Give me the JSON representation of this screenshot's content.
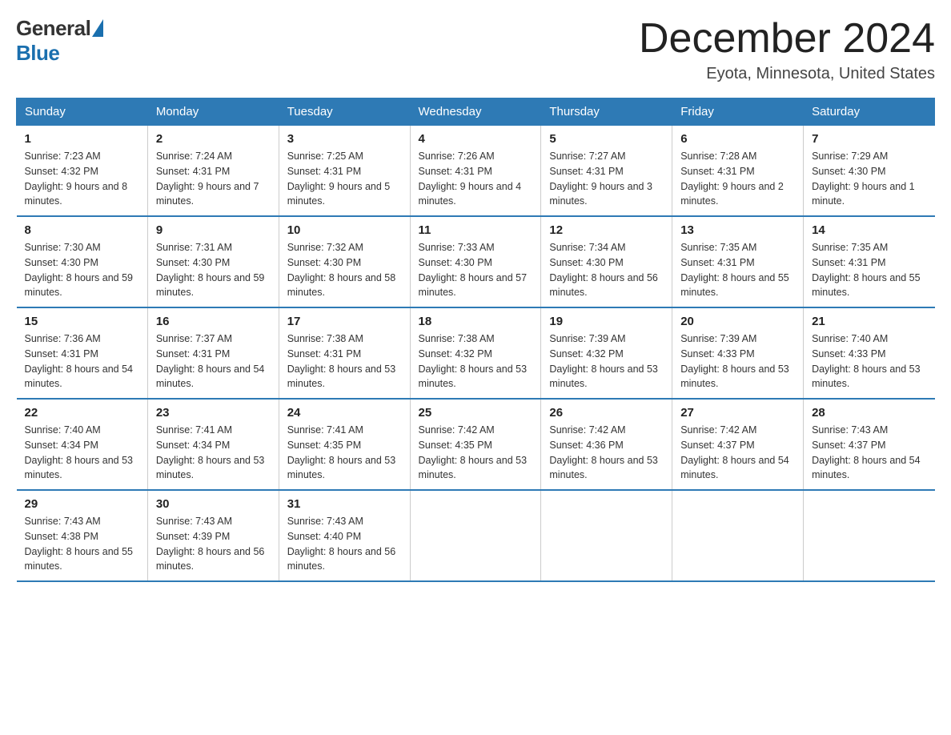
{
  "logo": {
    "general": "General",
    "blue": "Blue"
  },
  "title": "December 2024",
  "subtitle": "Eyota, Minnesota, United States",
  "headers": [
    "Sunday",
    "Monday",
    "Tuesday",
    "Wednesday",
    "Thursday",
    "Friday",
    "Saturday"
  ],
  "weeks": [
    [
      {
        "day": "1",
        "sunrise": "7:23 AM",
        "sunset": "4:32 PM",
        "daylight": "9 hours and 8 minutes."
      },
      {
        "day": "2",
        "sunrise": "7:24 AM",
        "sunset": "4:31 PM",
        "daylight": "9 hours and 7 minutes."
      },
      {
        "day": "3",
        "sunrise": "7:25 AM",
        "sunset": "4:31 PM",
        "daylight": "9 hours and 5 minutes."
      },
      {
        "day": "4",
        "sunrise": "7:26 AM",
        "sunset": "4:31 PM",
        "daylight": "9 hours and 4 minutes."
      },
      {
        "day": "5",
        "sunrise": "7:27 AM",
        "sunset": "4:31 PM",
        "daylight": "9 hours and 3 minutes."
      },
      {
        "day": "6",
        "sunrise": "7:28 AM",
        "sunset": "4:31 PM",
        "daylight": "9 hours and 2 minutes."
      },
      {
        "day": "7",
        "sunrise": "7:29 AM",
        "sunset": "4:30 PM",
        "daylight": "9 hours and 1 minute."
      }
    ],
    [
      {
        "day": "8",
        "sunrise": "7:30 AM",
        "sunset": "4:30 PM",
        "daylight": "8 hours and 59 minutes."
      },
      {
        "day": "9",
        "sunrise": "7:31 AM",
        "sunset": "4:30 PM",
        "daylight": "8 hours and 59 minutes."
      },
      {
        "day": "10",
        "sunrise": "7:32 AM",
        "sunset": "4:30 PM",
        "daylight": "8 hours and 58 minutes."
      },
      {
        "day": "11",
        "sunrise": "7:33 AM",
        "sunset": "4:30 PM",
        "daylight": "8 hours and 57 minutes."
      },
      {
        "day": "12",
        "sunrise": "7:34 AM",
        "sunset": "4:30 PM",
        "daylight": "8 hours and 56 minutes."
      },
      {
        "day": "13",
        "sunrise": "7:35 AM",
        "sunset": "4:31 PM",
        "daylight": "8 hours and 55 minutes."
      },
      {
        "day": "14",
        "sunrise": "7:35 AM",
        "sunset": "4:31 PM",
        "daylight": "8 hours and 55 minutes."
      }
    ],
    [
      {
        "day": "15",
        "sunrise": "7:36 AM",
        "sunset": "4:31 PM",
        "daylight": "8 hours and 54 minutes."
      },
      {
        "day": "16",
        "sunrise": "7:37 AM",
        "sunset": "4:31 PM",
        "daylight": "8 hours and 54 minutes."
      },
      {
        "day": "17",
        "sunrise": "7:38 AM",
        "sunset": "4:31 PM",
        "daylight": "8 hours and 53 minutes."
      },
      {
        "day": "18",
        "sunrise": "7:38 AM",
        "sunset": "4:32 PM",
        "daylight": "8 hours and 53 minutes."
      },
      {
        "day": "19",
        "sunrise": "7:39 AM",
        "sunset": "4:32 PM",
        "daylight": "8 hours and 53 minutes."
      },
      {
        "day": "20",
        "sunrise": "7:39 AM",
        "sunset": "4:33 PM",
        "daylight": "8 hours and 53 minutes."
      },
      {
        "day": "21",
        "sunrise": "7:40 AM",
        "sunset": "4:33 PM",
        "daylight": "8 hours and 53 minutes."
      }
    ],
    [
      {
        "day": "22",
        "sunrise": "7:40 AM",
        "sunset": "4:34 PM",
        "daylight": "8 hours and 53 minutes."
      },
      {
        "day": "23",
        "sunrise": "7:41 AM",
        "sunset": "4:34 PM",
        "daylight": "8 hours and 53 minutes."
      },
      {
        "day": "24",
        "sunrise": "7:41 AM",
        "sunset": "4:35 PM",
        "daylight": "8 hours and 53 minutes."
      },
      {
        "day": "25",
        "sunrise": "7:42 AM",
        "sunset": "4:35 PM",
        "daylight": "8 hours and 53 minutes."
      },
      {
        "day": "26",
        "sunrise": "7:42 AM",
        "sunset": "4:36 PM",
        "daylight": "8 hours and 53 minutes."
      },
      {
        "day": "27",
        "sunrise": "7:42 AM",
        "sunset": "4:37 PM",
        "daylight": "8 hours and 54 minutes."
      },
      {
        "day": "28",
        "sunrise": "7:43 AM",
        "sunset": "4:37 PM",
        "daylight": "8 hours and 54 minutes."
      }
    ],
    [
      {
        "day": "29",
        "sunrise": "7:43 AM",
        "sunset": "4:38 PM",
        "daylight": "8 hours and 55 minutes."
      },
      {
        "day": "30",
        "sunrise": "7:43 AM",
        "sunset": "4:39 PM",
        "daylight": "8 hours and 56 minutes."
      },
      {
        "day": "31",
        "sunrise": "7:43 AM",
        "sunset": "4:40 PM",
        "daylight": "8 hours and 56 minutes."
      },
      null,
      null,
      null,
      null
    ]
  ]
}
